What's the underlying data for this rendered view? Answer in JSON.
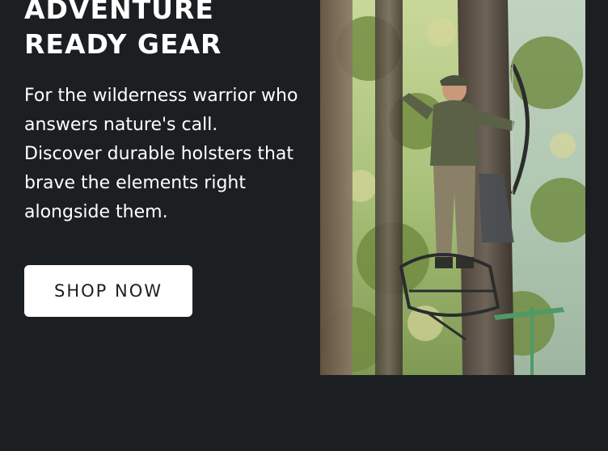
{
  "hero": {
    "title_line1": "ADVENTURE",
    "title_line2": "READY GEAR",
    "description": "For the wilderness warrior who answers nature's call. Discover durable holsters that brave the elements right alongside them.",
    "button_label": "SHOP NOW"
  },
  "photo": {
    "subject": "hunter-with-bow-on-tree-stand"
  },
  "colors": {
    "background": "#1c1f22",
    "text": "#ffffff",
    "button_bg": "#ffffff",
    "button_text": "#1c1f22"
  }
}
